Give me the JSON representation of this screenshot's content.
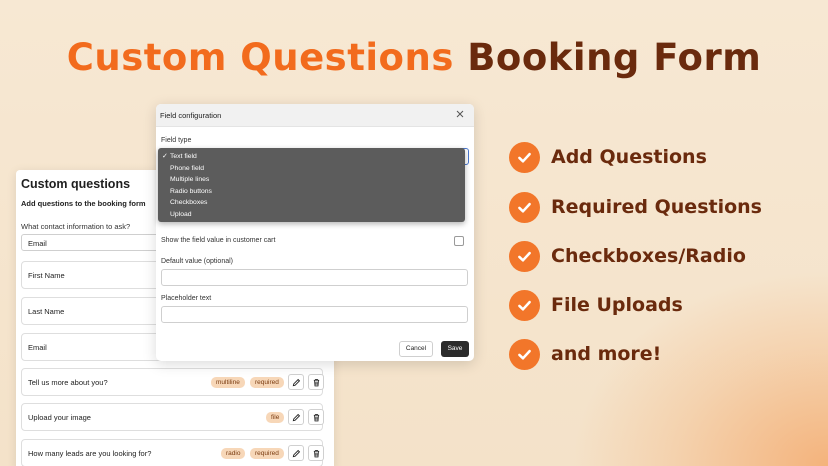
{
  "headline": {
    "part1": "Custom Questions",
    "part2": "Booking Form",
    "color_orange": "#f26b1d",
    "color_brown": "#6a2a0d"
  },
  "custom_questions": {
    "title": "Custom questions",
    "subtitle": "Add questions to the booking form",
    "contact_prompt": "What contact information to ask?",
    "contact_select_value": "Email",
    "fields": [
      "First Name",
      "Last Name",
      "Email"
    ],
    "questions": [
      {
        "text": "Tell us more about you?",
        "tags": [
          "multiline",
          "required"
        ]
      },
      {
        "text": "Upload your image",
        "tags": [
          "file"
        ]
      },
      {
        "text": "How many leads are you looking for?",
        "tags": [
          "radio",
          "required"
        ]
      }
    ],
    "edit_icon": "pencil-icon",
    "delete_icon": "trash-icon"
  },
  "field_config": {
    "title": "Field configuration",
    "field_type_label": "Field type",
    "field_type_options": [
      "Text field",
      "Phone field",
      "Multiple lines",
      "Radio buttons",
      "Checkboxes",
      "Upload"
    ],
    "selected_option": "Text field",
    "show_in_cart_label": "Show the field value in customer cart",
    "show_in_cart_checked": false,
    "default_value_label": "Default value (optional)",
    "default_value": "",
    "placeholder_label": "Placeholder text",
    "placeholder_value": "",
    "cancel_label": "Cancel",
    "save_label": "Save"
  },
  "features": [
    "Add Questions",
    "Required Questions",
    "Checkboxes/Radio",
    "File Uploads",
    "and more!"
  ],
  "colors": {
    "accent": "#f2762a",
    "feature_text": "#6a2a0d",
    "background": "#f6e6cf"
  }
}
